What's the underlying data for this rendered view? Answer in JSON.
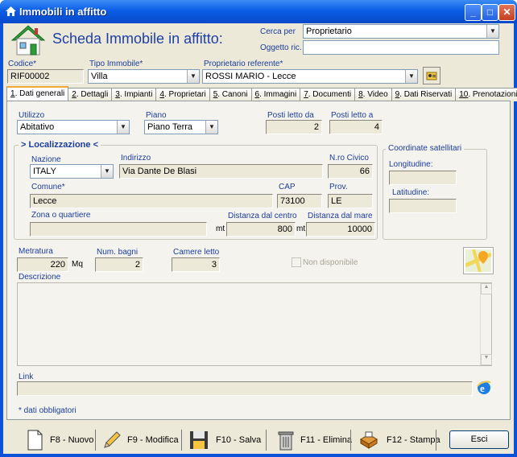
{
  "window": {
    "title": "Immobili in affitto"
  },
  "header": {
    "title": "Scheda Immobile in affitto:",
    "search_label": "Cerca per",
    "search_value": "Proprietario",
    "object_label": "Oggetto ric.",
    "object_value": ""
  },
  "top": {
    "codice_label": "Codice*",
    "codice": "RIF00002",
    "tipo_label": "Tipo Immobile*",
    "tipo": "Villa",
    "prop_label": "Proprietario referente*",
    "prop": "ROSSI MARIO - Lecce"
  },
  "tabs": [
    {
      "num": "1",
      "label": ". Dati generali"
    },
    {
      "num": "2",
      "label": ". Dettagli"
    },
    {
      "num": "3",
      "label": ". Impianti"
    },
    {
      "num": "4",
      "label": ". Proprietari"
    },
    {
      "num": "5",
      "label": ". Canoni"
    },
    {
      "num": "6",
      "label": ". Immagini"
    },
    {
      "num": "7",
      "label": ". Documenti"
    },
    {
      "num": "8",
      "label": ". Video"
    },
    {
      "num": "9",
      "label": ". Dati Riservati"
    },
    {
      "num": "10",
      "label": ". Prenotazioni"
    }
  ],
  "general": {
    "utilizzo_label": "Utilizzo",
    "utilizzo": "Abitativo",
    "piano_label": "Piano",
    "piano": "Piano Terra",
    "posti_da_label": "Posti letto da",
    "posti_da": "2",
    "posti_a_label": "Posti letto a",
    "posti_a": "4"
  },
  "loc": {
    "title": "Localizzazione",
    "prefix": ">",
    "suffix": "<",
    "nazione_label": "Nazione",
    "nazione": "ITALY",
    "indirizzo_label": "Indirizzo",
    "indirizzo": "Via Dante De Blasi",
    "civico_label": "N.ro Civico",
    "civico": "66",
    "comune_label": "Comune*",
    "comune": "Lecce",
    "cap_label": "CAP",
    "cap": "73100",
    "prov_label": "Prov.",
    "prov": "LE",
    "zona_label": "Zona o quartiere",
    "zona": "",
    "dist_centro_label": "Distanza dal centro",
    "dist_centro": "800",
    "unit_mt": "mt",
    "dist_mare_label": "Distanza dal mare",
    "dist_mare": "10000",
    "coord_title": "Coordinate satellitari",
    "long_label": "Longitudine:",
    "longitudine": "",
    "lat_label": "Latitudine:",
    "latitudine": ""
  },
  "misc": {
    "metratura_label": "Metratura",
    "metratura": "220",
    "unit_mq": "Mq",
    "bagni_label": "Num. bagni",
    "bagni": "2",
    "camere_label": "Camere letto",
    "camere": "3",
    "non_disp_label": "Non disponibile",
    "descr_label": "Descrizione",
    "descr": "",
    "link_label": "Link",
    "link": "",
    "note": "* dati obbligatori"
  },
  "footer": {
    "nuovo": "F8 - Nuovo",
    "modifica": "F9 - Modifica",
    "salva": "F10 - Salva",
    "elimina": "F11 - Elimina",
    "stampa": "F12 - Stampa",
    "esci": "Esci"
  },
  "icons": [
    "house-icon",
    "minimize-icon",
    "maximize-icon",
    "close-icon",
    "person-card-icon",
    "map-icon",
    "internet-explorer-icon",
    "document-icon",
    "pencil-icon",
    "floppy-disk-icon",
    "trash-bin-icon",
    "printer-icon"
  ]
}
